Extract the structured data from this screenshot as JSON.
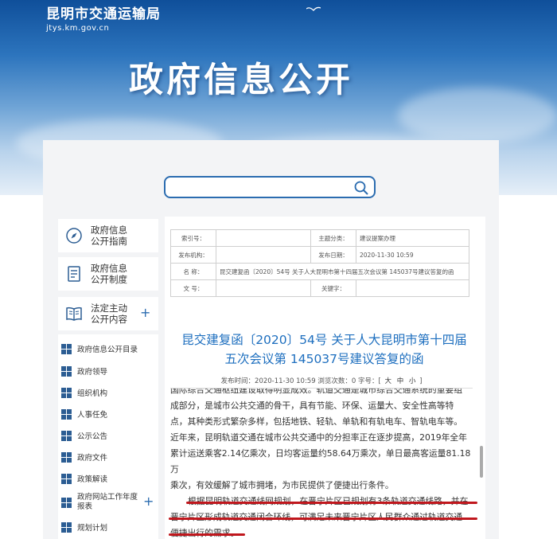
{
  "site": {
    "name": "昆明市交通运输局",
    "domain": "jtys.km.gov.cn"
  },
  "hero_title": "政府信息公开",
  "search": {
    "placeholder": ""
  },
  "sidebar": {
    "guide": "政府信息\n公开指南",
    "system": "政府信息\n公开制度",
    "legal": "法定主动\n公开内容"
  },
  "submenu": [
    "政府信息公开目录",
    "政府领导",
    "组织机构",
    "人事任免",
    "公示公告",
    "政府文件",
    "政策解读",
    "政府网站工作年度\n报表",
    "规划计划"
  ],
  "meta": {
    "index_label": "索引号：",
    "index_value": "",
    "topic_label": "主题分类：",
    "topic_value": "建议提案办理",
    "org_label": "发布机构：",
    "org_value": "",
    "date_label": "发布日期：",
    "date_value": "2020-11-30 10:59",
    "name_label": "名  称：",
    "name_value": "昆交建复函〔2020〕54号 关于人大昆明市第十四届五次会议第 145037号建议答复的函",
    "doc_label": "文  号：",
    "doc_value": "",
    "kw_label": "关键字：",
    "kw_value": ""
  },
  "article": {
    "title": "昆交建复函〔2020〕54号 关于人大昆明市第十四届五次会议第 145037号建议答复的函",
    "info_prefix": "发布时间：2020-11-30 10:59  浏览次数：0 字号：[",
    "size_large": "大",
    "size_mid": "中",
    "size_small": "小",
    "info_suffix": "]",
    "p1_lines": [
      "国际综合交通枢纽建设取得明显成效。轨道交通是城市综合交通系统的重要组",
      "成部分，是城市公共交通的骨干，具有节能、环保、运量大、安全性高等特",
      "点，其种类形式繁杂多样，包括地铁、轻轨、单轨和有轨电车、智轨电车等。",
      "近年来，昆明轨道交通在城市公共交通中的分担率正在逐步提高，2019年全年",
      "累计运送乘客2.14亿乘次，日均客运量约58.64万乘次，单日最高客运量81.18万",
      "乘次，有效缓解了城市拥堵，为市民提供了便捷出行条件。"
    ],
    "p2_lines": [
      "根据昆明轨道交通线网规划，在晋宁片区已规划有3条轨道交通线路，并在",
      "晋宁片区形成轨道交通闭合环线，可满足未来晋宁片区人民群众通过轨道交通",
      "便捷出行的需求。"
    ]
  },
  "colors": {
    "accent": "#1e6fbf",
    "underline": "#c0171d",
    "banner": "#2c74bd"
  }
}
